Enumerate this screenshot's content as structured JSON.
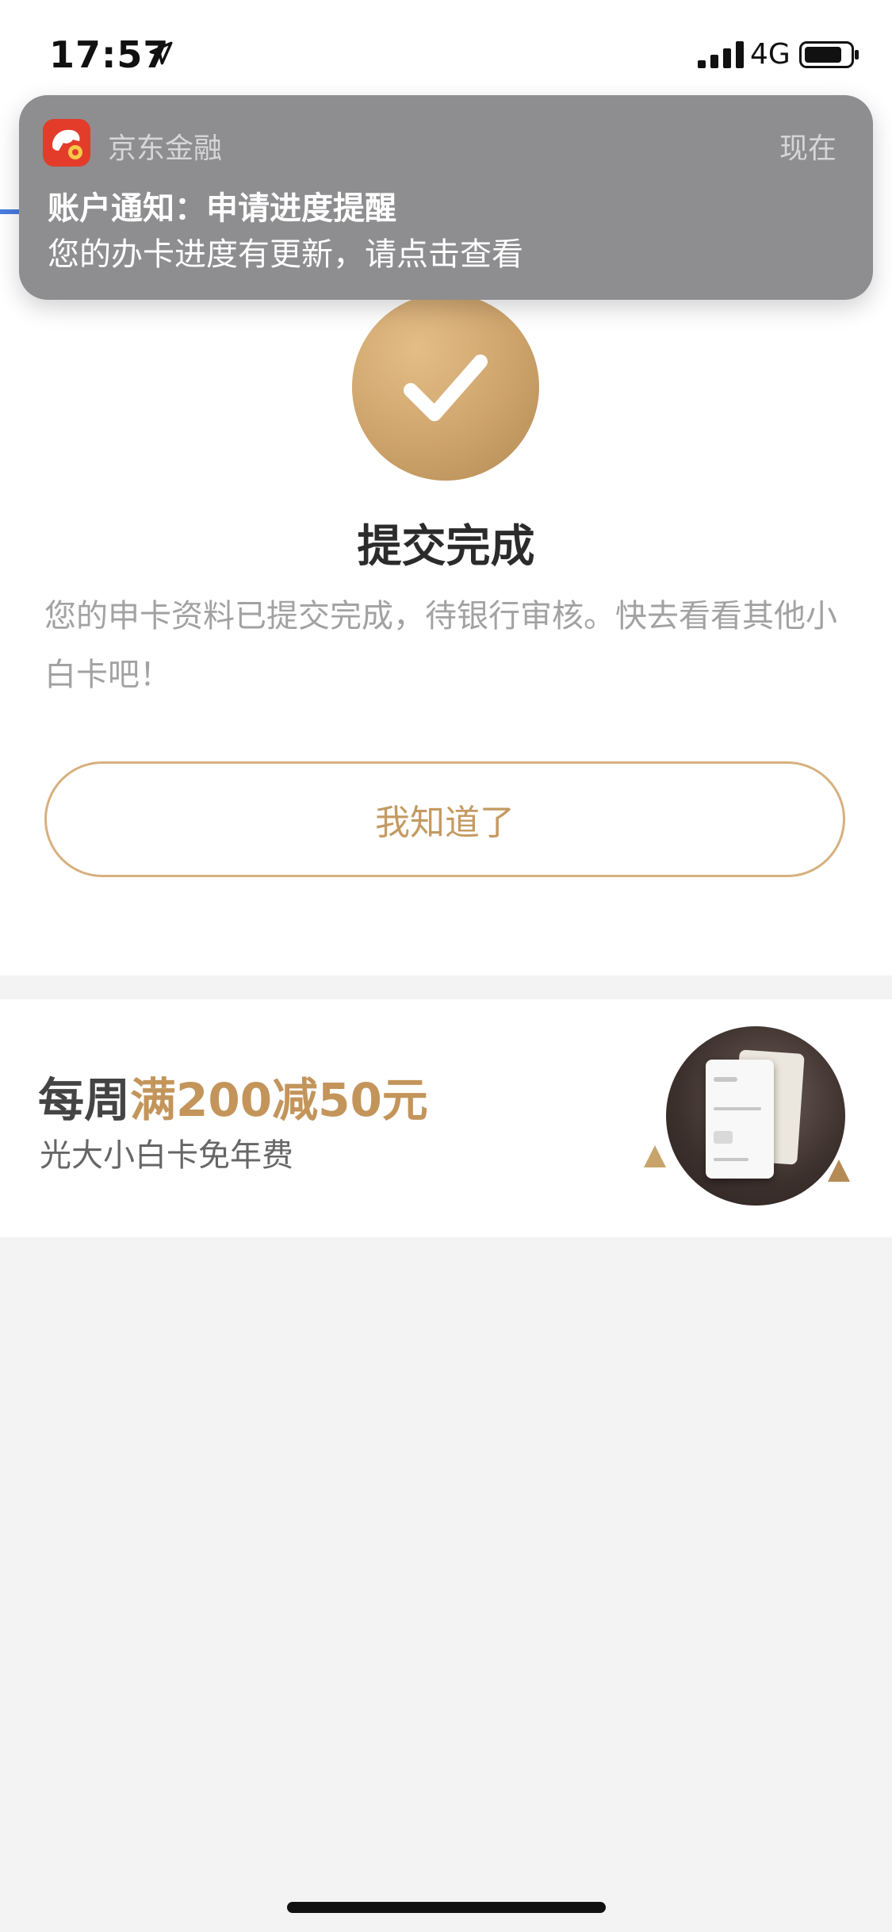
{
  "status_bar": {
    "time": "17:57",
    "network": "4G"
  },
  "notification": {
    "app_name": "京东金融",
    "time": "现在",
    "title": "账户通知：申请进度提醒",
    "body": "您的办卡进度有更新，请点击查看"
  },
  "result": {
    "title": "提交完成",
    "description": "您的申卡资料已提交完成，待银行审核。快去看看其他小白卡吧！",
    "button_label": "我知道了"
  },
  "promo": {
    "title_prefix": "每周",
    "title_highlight": "满200减50元",
    "subtitle": "光大小白卡免年费"
  },
  "colors": {
    "accent_gold": "#c3955b",
    "notification_bg": "#8e8e90",
    "app_icon_red": "#e33c2b"
  },
  "icons": [
    "location-arrow-icon",
    "signal-icon",
    "battery-icon",
    "jd-finance-app-icon",
    "check-icon"
  ]
}
